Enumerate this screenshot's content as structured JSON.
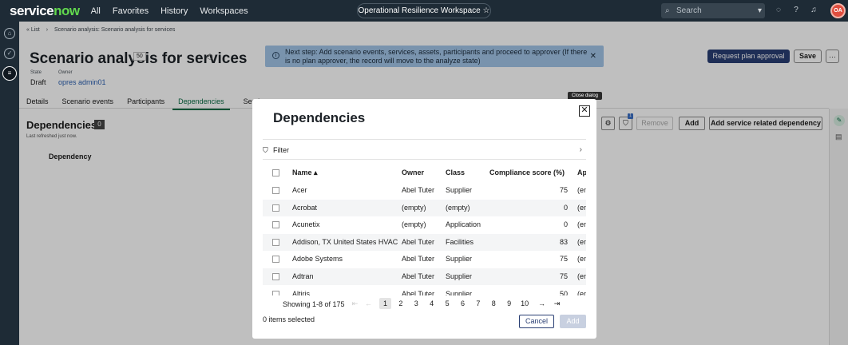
{
  "topbar": {
    "logo": "servicenow",
    "nav": [
      "All",
      "Favorites",
      "History",
      "Workspaces"
    ],
    "workspace": "Operational Resilience Workspace",
    "search_placeholder": "Search",
    "avatar": "OA"
  },
  "breadcrumb": {
    "list": "List",
    "current": "Scenario analysis: Scenario analysis for services"
  },
  "record": {
    "title": "Scenario analysis for services",
    "badge": "50",
    "state_label": "State",
    "state_value": "Draft",
    "owner_label": "Owner",
    "owner_value": "opres admin01"
  },
  "banner": {
    "text": "Next step: Add scenario events, services, assets, participants and proceed to approver (If there is no plan approver, the record will move to the analyze state)"
  },
  "actions": {
    "request": "Request plan approval",
    "save": "Save"
  },
  "tabs": [
    "Details",
    "Scenario events",
    "Participants",
    "Dependencies",
    "Services"
  ],
  "dependencies": {
    "header": "Dependencies",
    "count": "0",
    "refreshed": "Last refreshed just now.",
    "column": "Dependency",
    "remove": "Remove",
    "add": "Add",
    "add_service": "Add service related dependency",
    "filter_badge": "1"
  },
  "tooltip": "Close dialog",
  "modal": {
    "title": "Dependencies",
    "filter": "Filter",
    "columns": [
      "Name",
      "Owner",
      "Class",
      "Compliance score (%)",
      "Ap"
    ],
    "rows": [
      {
        "name": "Acer",
        "owner": "Abel Tuter",
        "class": "Supplier",
        "score": "75",
        "ap": "(em"
      },
      {
        "name": "Acrobat",
        "owner": "(empty)",
        "class": "(empty)",
        "score": "0",
        "ap": "(em"
      },
      {
        "name": "Acunetix",
        "owner": "(empty)",
        "class": "Application",
        "score": "0",
        "ap": "(em"
      },
      {
        "name": "Addison, TX United States HVAC",
        "owner": "Abel Tuter",
        "class": "Facilities",
        "score": "83",
        "ap": "(em"
      },
      {
        "name": "Adobe Systems",
        "owner": "Abel Tuter",
        "class": "Supplier",
        "score": "75",
        "ap": "(em"
      },
      {
        "name": "Adtran",
        "owner": "Abel Tuter",
        "class": "Supplier",
        "score": "75",
        "ap": "(em"
      },
      {
        "name": "Altiris",
        "owner": "Abel Tuter",
        "class": "Supplier",
        "score": "50",
        "ap": "(em"
      }
    ],
    "showing": "Showing 1-8 of 175",
    "pages": [
      "1",
      "2",
      "3",
      "4",
      "5",
      "6",
      "7",
      "8",
      "9",
      "10"
    ],
    "current_page": "1",
    "selected": "0 items selected",
    "cancel": "Cancel",
    "add": "Add"
  }
}
